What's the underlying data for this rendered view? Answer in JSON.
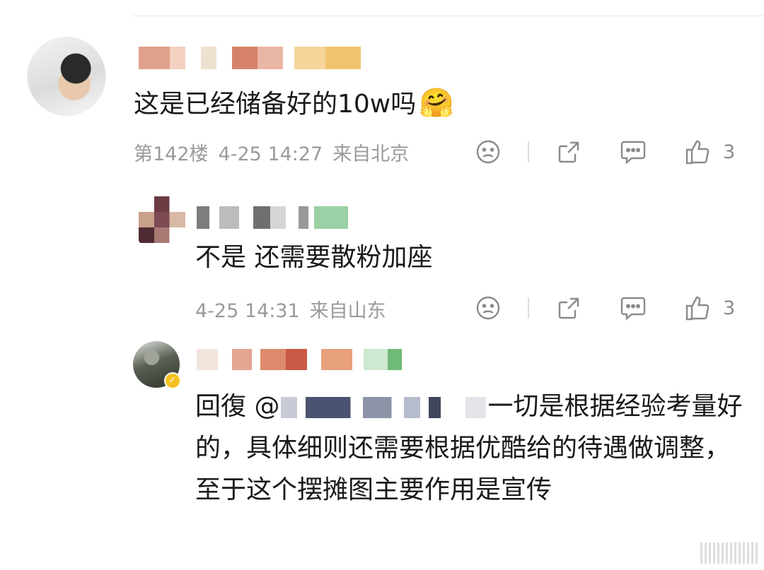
{
  "comments": [
    {
      "text": "这是已经储备好的10w吗",
      "emoji": "🤗",
      "floor": "第142楼",
      "datetime": "4-25 14:27",
      "location": "来自北京",
      "like_count": "3"
    },
    {
      "text": "不是 还需要散粉加座",
      "datetime": "4-25 14:31",
      "location": "来自山东",
      "like_count": "3"
    },
    {
      "reply_prefix": "回復 @",
      "text": "一切是根据经验考量好的，具体细则还需要根据优酷给的待遇做调整，至于这个摆摊图主要作用是宣传"
    }
  ],
  "icons": {
    "dislike": "frown-face-icon",
    "share": "share-icon",
    "reply": "comment-icon",
    "like": "thumbs-up-icon",
    "verified": "verified-badge-icon"
  },
  "colors": {
    "text": "#1a1a1a",
    "meta": "#9a9a9a",
    "icon": "#8a8a8a",
    "divider": "#e6e6e6",
    "verified": "#f4c21f"
  }
}
